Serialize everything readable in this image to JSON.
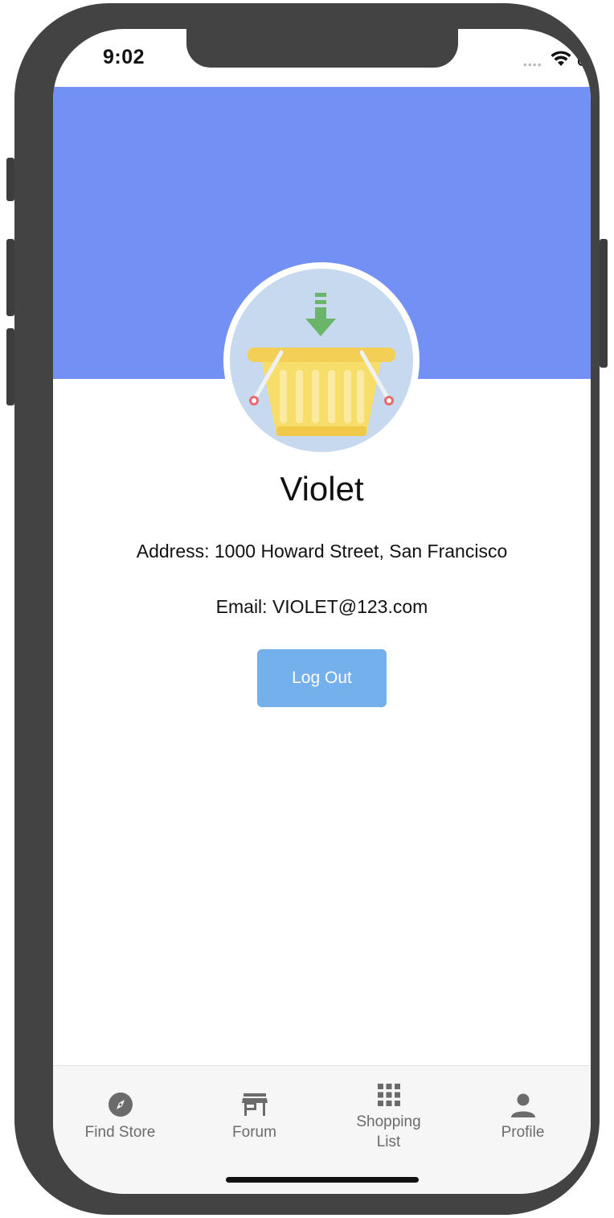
{
  "status_bar": {
    "time": "9:02"
  },
  "profile": {
    "name": "Violet",
    "address": "Address: 1000 Howard Street, San Francisco",
    "email": "Email: VIOLET@123.com",
    "logout_label": "Log Out"
  },
  "tabs": [
    {
      "label": "Find Store",
      "icon": "compass-icon"
    },
    {
      "label": "Forum",
      "icon": "store-icon"
    },
    {
      "label": "Shopping List",
      "icon": "grid-icon"
    },
    {
      "label": "Profile",
      "icon": "person-icon"
    }
  ],
  "colors": {
    "header": "#7391f5",
    "button": "#74b0ec",
    "tab_icon": "#6b6b6b"
  }
}
